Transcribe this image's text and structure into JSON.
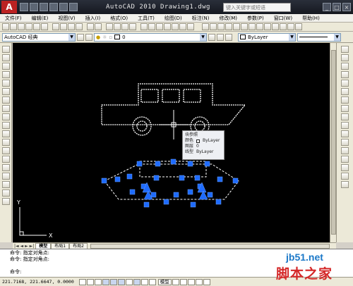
{
  "window": {
    "title": "AutoCAD 2010  Drawing1.dwg",
    "search_placeholder": "键入关键字或短语",
    "logo": "A",
    "minimize": "_",
    "maximize": "□",
    "close": "×"
  },
  "menu": [
    "文件(F)",
    "编辑(E)",
    "视图(V)",
    "插入(I)",
    "格式(O)",
    "工具(T)",
    "绘图(D)",
    "标注(N)",
    "修改(M)",
    "参数(P)",
    "窗口(W)",
    "帮助(H)"
  ],
  "workspace": {
    "value": "AutoCAD 经典"
  },
  "layer": {
    "value": "0"
  },
  "color_control": {
    "value": "ByLayer"
  },
  "linetype_control": {
    "value": "ByLayer"
  },
  "tooltip": {
    "title": "块参照",
    "color_label": "颜色",
    "color_value": "ByLayer",
    "layer_label": "图层",
    "layer_value": "0",
    "linetype_label": "线型",
    "linetype_value": "ByLayer"
  },
  "tabs": {
    "nav": "|◄ ◄ ► ►|",
    "items": [
      "模型",
      "布局1",
      "布局2"
    ]
  },
  "ucs": {
    "x": "X",
    "y": "Y"
  },
  "command_lines": [
    "命令: 指定对角点:",
    "命令: 指定对角点:",
    "",
    "命令:"
  ],
  "status": {
    "coords": "221.7168, 221.6647, 0.0000",
    "model": "模型"
  },
  "watermark": {
    "site": "jb51.net",
    "name": "脚本之家"
  },
  "colors": {
    "canvas": "#000000",
    "car": "#ffffff",
    "grip": "#1e6bff",
    "selection": "#ffffff"
  }
}
